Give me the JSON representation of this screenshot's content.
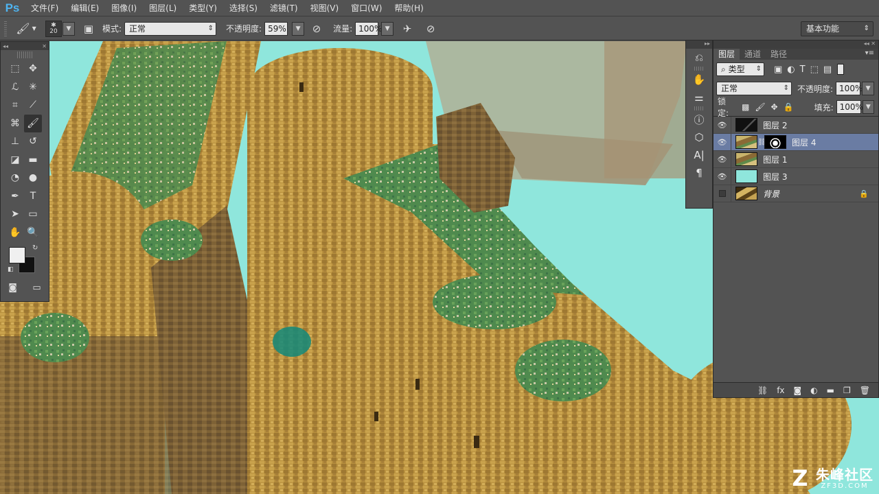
{
  "app": {
    "logo": "Ps"
  },
  "menu": [
    "文件(F)",
    "编辑(E)",
    "图像(I)",
    "图层(L)",
    "类型(Y)",
    "选择(S)",
    "滤镜(T)",
    "视图(V)",
    "窗口(W)",
    "帮助(H)"
  ],
  "options": {
    "brush_size": "20",
    "mode_label": "模式:",
    "mode_value": "正常",
    "opacity_label": "不透明度:",
    "opacity_value": "59%",
    "flow_label": "流量:",
    "flow_value": "100%",
    "workspace": "基本功能"
  },
  "layers_panel": {
    "tabs": [
      "图层",
      "通道",
      "路径"
    ],
    "filter_label": "类型",
    "blend_mode": "正常",
    "opacity_label": "不透明度:",
    "opacity_value": "100%",
    "lock_label": "锁定:",
    "fill_label": "填充:",
    "fill_value": "100%",
    "layers": [
      {
        "name": "图层 2",
        "visible": true,
        "selected": false,
        "thumb": "dark"
      },
      {
        "name": "图层 4",
        "visible": true,
        "selected": true,
        "thumb": "castle",
        "mask": true
      },
      {
        "name": "图层 1",
        "visible": true,
        "selected": false,
        "thumb": "castle"
      },
      {
        "name": "图层 3",
        "visible": true,
        "selected": false,
        "thumb": "cyan"
      },
      {
        "name": "背景",
        "visible": false,
        "selected": false,
        "thumb": "brown",
        "locked": true
      }
    ]
  },
  "watermark": {
    "logo": "Z",
    "name": "朱峰社区",
    "url": "ZF3D.COM"
  },
  "icons": {
    "brush": "brush-icon",
    "eye": "eye-icon",
    "lock": "lock-icon"
  }
}
